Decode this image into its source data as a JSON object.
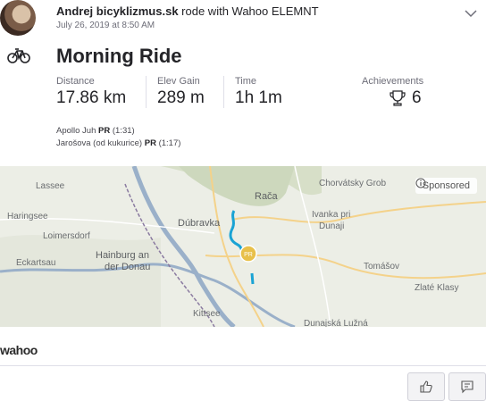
{
  "header": {
    "athlete_name": "Andrej bicyklizmus.sk",
    "action_text": " rode with Wahoo ELEMNT",
    "timestamp": "July 26, 2019 at 8:50 AM"
  },
  "activity": {
    "type_icon": "bicycle-icon",
    "title": "Morning Ride"
  },
  "stats": [
    {
      "label": "Distance",
      "value": "17.86 km"
    },
    {
      "label": "Elev Gain",
      "value": "289 m"
    },
    {
      "label": "Time",
      "value": "1h 1m"
    }
  ],
  "achievements": {
    "label": "Achievements",
    "value": "6",
    "icon": "trophy-icon"
  },
  "segments": [
    {
      "name": "Apollo Juh",
      "badge": "PR",
      "time": "(1:31)"
    },
    {
      "name": "Jarošova (od kukurice)",
      "badge": "PR",
      "time": "(1:17)"
    }
  ],
  "map": {
    "sponsored_label": "Sponsored",
    "route_color": "#1aa3d4",
    "pr_marker_label": "PR",
    "places": [
      "Lassee",
      "Haringsee",
      "Loimersdorf",
      "Eckartsau",
      "Hainburg an",
      "der Donau",
      "Dúbravka",
      "Rača",
      "Chorvátsky Grob",
      "Ivanka pri",
      "Dunaji",
      "Tomášov",
      "Zlaté Klasy",
      "Kittsee",
      "Dunajská Lužná"
    ]
  },
  "device_brand": "wahoo",
  "actions": {
    "kudos_icon": "thumbs-up-icon",
    "comment_icon": "comment-icon"
  }
}
